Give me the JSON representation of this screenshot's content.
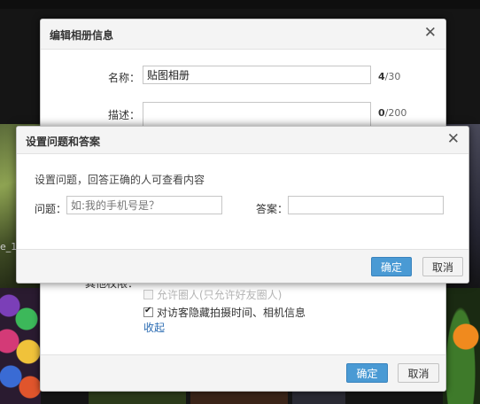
{
  "background": {
    "caption_fragment": "e_1"
  },
  "edit_dialog": {
    "title": "编辑相册信息",
    "close_icon": "close-icon",
    "name_label": "名称：",
    "name_value": "贴图相册",
    "name_count": "4",
    "name_max": "/30",
    "desc_label": "描述：",
    "desc_value": "",
    "desc_count": "0",
    "desc_max": "/200",
    "permission_label_partial": "其他权限：",
    "option_allow_circle": "允许圈人(只允许好友圈人)",
    "option_allow_circle_checked": false,
    "option_hide_info": "对访客隐藏拍摄时间、相机信息",
    "option_hide_info_checked": true,
    "collapse_link": "收起",
    "confirm_label": "确定",
    "cancel_label": "取消"
  },
  "question_dialog": {
    "title": "设置问题和答案",
    "close_icon": "close-icon",
    "description": "设置问题，回答正确的人可查看内容",
    "question_label": "问题：",
    "question_placeholder": "如:我的手机号是？",
    "question_value": "",
    "answer_label": "答案：",
    "answer_value": "",
    "confirm_label": "确定",
    "cancel_label": "取消"
  },
  "colors": {
    "primary_button": "#4a9ad4",
    "link": "#2a6bb2",
    "dialog_header": "#f4f4f4"
  }
}
